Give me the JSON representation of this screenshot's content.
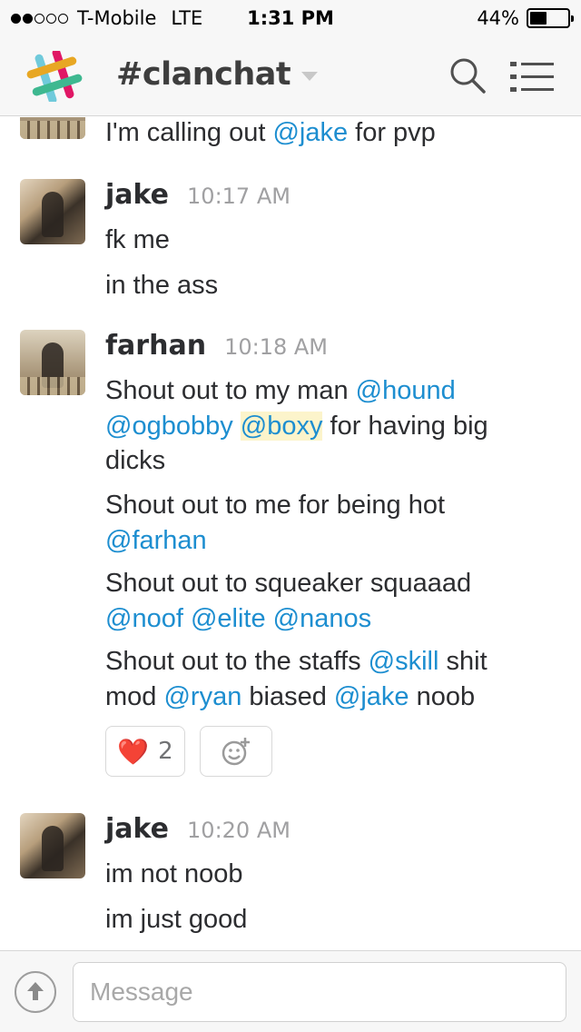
{
  "status_bar": {
    "carrier": "T-Mobile",
    "network": "LTE",
    "time": "1:31 PM",
    "battery_label": "44%",
    "battery_level": 0.44
  },
  "header": {
    "channel": "#clanchat",
    "search_icon": "search-icon",
    "menu_icon": "menu-icon"
  },
  "messages": {
    "partial": {
      "line1": {
        "a": "I'm calling out ",
        "m1": "@jake",
        "b": "  for pvp"
      }
    },
    "jake1": {
      "author": "jake",
      "time": "10:17 AM",
      "line1": "fk me",
      "line2": "in the ass"
    },
    "farhan": {
      "author": "farhan",
      "time": "10:18 AM",
      "p1": {
        "a": "Shout out to my man ",
        "m1": "@hound",
        "m2": "@ogbobby",
        "m3": "@boxy",
        "b": "  for having big",
        "c": "dicks"
      },
      "p2": {
        "a": "Shout out to me for being hot",
        "m1": "@farhan"
      },
      "p3": {
        "a": "Shout out to squeaker squaaad",
        "m1": "@noof",
        "m2": "@elite",
        "m3": "@nanos"
      },
      "p4": {
        "a": "Shout out to the staffs ",
        "m1": "@skill",
        "b": " shit",
        "c": "mod  ",
        "m2": "@ryan",
        "d": "  biased ",
        "m3": "@jake",
        "e": " noob"
      },
      "reaction": {
        "emoji": "❤️",
        "count": "2"
      }
    },
    "jake2": {
      "author": "jake",
      "time": "10:20 AM",
      "line1": "im not noob",
      "line2": "im just good"
    }
  },
  "composer": {
    "placeholder": "Message"
  }
}
